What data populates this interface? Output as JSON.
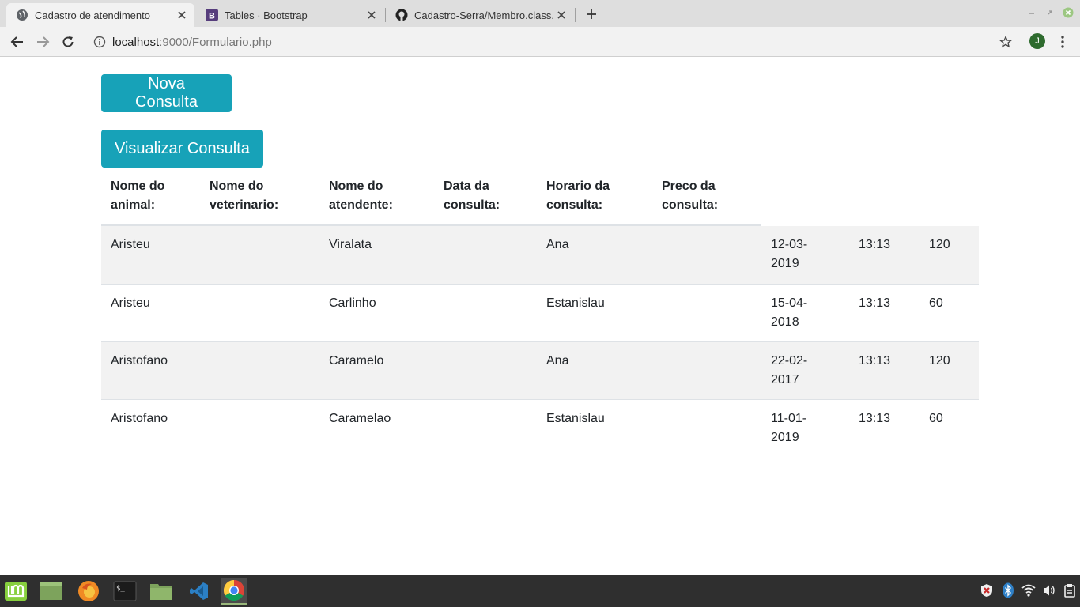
{
  "browser": {
    "tabs": [
      {
        "title": "Cadastro de atendimento",
        "active": true,
        "icon": "globe-icon"
      },
      {
        "title": "Tables · Bootstrap",
        "active": false,
        "icon": "bootstrap-icon"
      },
      {
        "title": "Cadastro-Serra/Membro.class.",
        "active": false,
        "icon": "github-icon"
      }
    ],
    "url_host": "localhost",
    "url_rest": ":9000/Formulario.php",
    "profile_initial": "J"
  },
  "page": {
    "new_button": "Nova Consulta",
    "view_button": "Visualizar Consulta",
    "columns": [
      "Nome do animal:",
      "Nome do veterinario:",
      "Nome do atendente:",
      "Data da consulta:",
      "Horario da consulta:",
      "Preco da consulta:"
    ],
    "rows": [
      [
        "Aristeu",
        "Viralata",
        "Ana",
        "12-03-2019",
        "13:13",
        "120"
      ],
      [
        "Aristeu",
        "Carlinho",
        "Estanislau",
        "15-04-2018",
        "13:13",
        "60"
      ],
      [
        "Aristofano",
        "Caramelo",
        "Ana",
        "22-02-2017",
        "13:13",
        "120"
      ],
      [
        "Aristofano",
        "Caramelao",
        "Estanislau",
        "11-01-2019",
        "13:13",
        "60"
      ]
    ]
  },
  "colors": {
    "button_bg": "#17a2b8",
    "stripe": "#f2f2f2",
    "taskbar": "#2f2f2f"
  },
  "taskbar": {
    "apps": [
      "mint-menu-icon",
      "desktop-folder-icon",
      "firefox-icon",
      "terminal-icon",
      "files-icon",
      "vscode-icon",
      "chrome-icon"
    ],
    "tray": [
      "shield-icon",
      "bluetooth-icon",
      "wifi-icon",
      "volume-icon",
      "clipboard-icon"
    ]
  }
}
